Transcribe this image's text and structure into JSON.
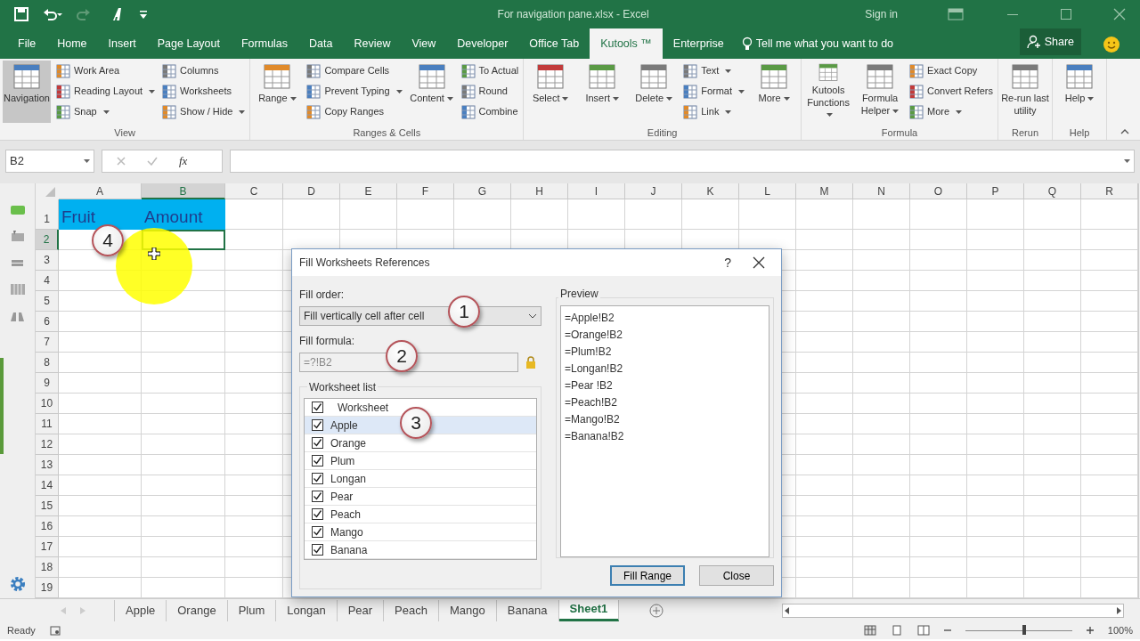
{
  "title_bar": {
    "title": "For navigation pane.xlsx  -  Excel",
    "sign_in": "Sign in"
  },
  "ribbon_tabs": [
    {
      "label": "File",
      "selected": false
    },
    {
      "label": "Home",
      "selected": false
    },
    {
      "label": "Insert",
      "selected": false
    },
    {
      "label": "Page Layout",
      "selected": false
    },
    {
      "label": "Formulas",
      "selected": false
    },
    {
      "label": "Data",
      "selected": false
    },
    {
      "label": "Review",
      "selected": false
    },
    {
      "label": "View",
      "selected": false
    },
    {
      "label": "Developer",
      "selected": false
    },
    {
      "label": "Office Tab",
      "selected": false
    },
    {
      "label": "Kutools ™",
      "selected": true
    },
    {
      "label": "Enterprise",
      "selected": false
    }
  ],
  "tell_me": {
    "placeholder": "Tell me what you want to do"
  },
  "share": "Share",
  "ribbon_groups": [
    {
      "label": "View",
      "items": [
        {
          "label": "Navigation",
          "kind": "large",
          "dropdown": false,
          "pressed": true
        },
        {
          "label": "Work Area",
          "kind": "small",
          "dropdown": false
        },
        {
          "label": "Reading Layout",
          "kind": "small",
          "dropdown": true
        },
        {
          "label": "Snap",
          "kind": "small",
          "dropdown": true
        },
        {
          "label": "Columns",
          "kind": "small",
          "dropdown": false
        },
        {
          "label": "Worksheets",
          "kind": "small",
          "dropdown": false
        },
        {
          "label": "Show / Hide",
          "kind": "small",
          "dropdown": true
        }
      ]
    },
    {
      "label": "Ranges & Cells",
      "items": [
        {
          "label": "Range",
          "kind": "large",
          "dropdown": true
        },
        {
          "label": "Compare Cells",
          "kind": "small",
          "dropdown": false
        },
        {
          "label": "Prevent Typing",
          "kind": "small",
          "dropdown": true
        },
        {
          "label": "Copy Ranges",
          "kind": "small",
          "dropdown": false
        },
        {
          "label": "Content",
          "kind": "large",
          "dropdown": true
        },
        {
          "label": "To Actual",
          "kind": "small",
          "dropdown": false
        },
        {
          "label": "Round",
          "kind": "small",
          "dropdown": false
        },
        {
          "label": "Combine",
          "kind": "small",
          "dropdown": false
        }
      ]
    },
    {
      "label": "Editing",
      "items": [
        {
          "label": "Select",
          "kind": "large",
          "dropdown": true
        },
        {
          "label": "Insert",
          "kind": "large",
          "dropdown": true
        },
        {
          "label": "Delete",
          "kind": "large",
          "dropdown": true
        },
        {
          "label": "Text",
          "kind": "small",
          "dropdown": true
        },
        {
          "label": "Format",
          "kind": "small",
          "dropdown": true
        },
        {
          "label": "Link",
          "kind": "small",
          "dropdown": true
        },
        {
          "label": "More",
          "kind": "large",
          "dropdown": true
        }
      ]
    },
    {
      "label": "Formula",
      "items": [
        {
          "label": "Kutools Functions",
          "kind": "large",
          "dropdown": true
        },
        {
          "label": "Formula Helper",
          "kind": "large",
          "dropdown": true
        },
        {
          "label": "Exact Copy",
          "kind": "small",
          "dropdown": false
        },
        {
          "label": "Convert Refers",
          "kind": "small",
          "dropdown": false
        },
        {
          "label": "More",
          "kind": "small",
          "dropdown": true
        }
      ]
    },
    {
      "label": "Rerun",
      "items": [
        {
          "label": "Re-run last utility",
          "kind": "large",
          "dropdown": false
        }
      ]
    },
    {
      "label": "Help",
      "items": [
        {
          "label": "Help",
          "kind": "large",
          "dropdown": true
        }
      ]
    }
  ],
  "formula_bar": {
    "name_box": "B2",
    "function_label": "fx"
  },
  "columns": [
    {
      "label": "A",
      "selected": false
    },
    {
      "label": "B",
      "selected": true
    },
    {
      "label": "C",
      "selected": false
    },
    {
      "label": "D",
      "selected": false
    },
    {
      "label": "E",
      "selected": false
    },
    {
      "label": "F",
      "selected": false
    },
    {
      "label": "G",
      "selected": false
    },
    {
      "label": "H",
      "selected": false
    },
    {
      "label": "I",
      "selected": false
    },
    {
      "label": "J",
      "selected": false
    },
    {
      "label": "K",
      "selected": false
    },
    {
      "label": "L",
      "selected": false
    },
    {
      "label": "M",
      "selected": false
    },
    {
      "label": "N",
      "selected": false
    },
    {
      "label": "O",
      "selected": false
    },
    {
      "label": "P",
      "selected": false
    },
    {
      "label": "Q",
      "selected": false
    },
    {
      "label": "R",
      "selected": false
    }
  ],
  "rows": [
    {
      "label": "1",
      "selected": false,
      "cells": [
        {
          "text": "Fruit",
          "highlighted": true
        },
        {
          "text": "Amount",
          "highlighted": true
        }
      ]
    },
    {
      "label": "2",
      "selected": true,
      "cells": []
    },
    {
      "label": "3",
      "selected": false,
      "cells": []
    },
    {
      "label": "4",
      "selected": false,
      "cells": []
    },
    {
      "label": "5",
      "selected": false,
      "cells": []
    },
    {
      "label": "6",
      "selected": false,
      "cells": []
    },
    {
      "label": "7",
      "selected": false,
      "cells": []
    },
    {
      "label": "8",
      "selected": false,
      "cells": []
    },
    {
      "label": "9",
      "selected": false,
      "cells": []
    },
    {
      "label": "10",
      "selected": false,
      "cells": []
    },
    {
      "label": "11",
      "selected": false,
      "cells": []
    },
    {
      "label": "12",
      "selected": false,
      "cells": []
    },
    {
      "label": "13",
      "selected": false,
      "cells": []
    },
    {
      "label": "14",
      "selected": false,
      "cells": []
    },
    {
      "label": "15",
      "selected": false,
      "cells": []
    },
    {
      "label": "16",
      "selected": false,
      "cells": []
    },
    {
      "label": "17",
      "selected": false,
      "cells": []
    },
    {
      "label": "18",
      "selected": false,
      "cells": []
    },
    {
      "label": "19",
      "selected": false,
      "cells": []
    }
  ],
  "dialog": {
    "title": "Fill Worksheets References",
    "help": "?",
    "fill_order": {
      "label": "Fill order:",
      "value": "Fill vertically cell after cell"
    },
    "fill_formula": {
      "label": "Fill formula:",
      "value": "=?!B2",
      "disabled": true
    },
    "worksheet_list": {
      "label": "Worksheet list",
      "header": {
        "label": "Worksheet",
        "checked": true
      },
      "items": [
        {
          "label": "Apple",
          "checked": true,
          "selected": true
        },
        {
          "label": "Orange",
          "checked": true,
          "selected": false
        },
        {
          "label": "Plum",
          "checked": true,
          "selected": false
        },
        {
          "label": "Longan",
          "checked": true,
          "selected": false
        },
        {
          "label": "Pear",
          "checked": true,
          "selected": false
        },
        {
          "label": "Peach",
          "checked": true,
          "selected": false
        },
        {
          "label": "Mango",
          "checked": true,
          "selected": false
        },
        {
          "label": "Banana",
          "checked": true,
          "selected": false
        }
      ]
    },
    "preview": {
      "label": "Preview",
      "lines": [
        "=Apple!B2",
        "=Orange!B2",
        "=Plum!B2",
        "=Longan!B2",
        "=Pear !B2",
        "=Peach!B2",
        "=Mango!B2",
        "=Banana!B2"
      ]
    },
    "buttons": [
      {
        "label": "Fill Range",
        "default": true
      },
      {
        "label": "Close",
        "default": false
      }
    ]
  },
  "callouts": [
    "1",
    "2",
    "3",
    "4"
  ],
  "sheet_tabs": [
    {
      "label": "Apple",
      "selected": false
    },
    {
      "label": "Orange",
      "selected": false
    },
    {
      "label": "Plum",
      "selected": false
    },
    {
      "label": "Longan",
      "selected": false
    },
    {
      "label": "Pear",
      "selected": false
    },
    {
      "label": "Peach",
      "selected": false
    },
    {
      "label": "Mango",
      "selected": false
    },
    {
      "label": "Banana",
      "selected": false
    },
    {
      "label": "Sheet1",
      "selected": true
    }
  ],
  "status_bar": {
    "status": "Ready",
    "zoom": {
      "reading": "100%",
      "level": 0.55
    }
  }
}
